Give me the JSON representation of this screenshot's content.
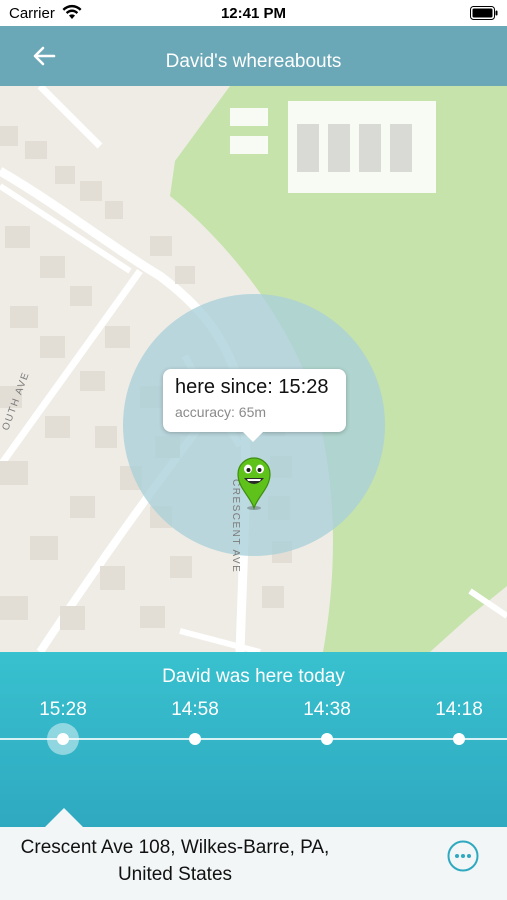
{
  "status_bar": {
    "carrier": "Carrier",
    "time": "12:41 PM"
  },
  "header": {
    "title": "David's whereabouts",
    "back_icon": "back-arrow-icon"
  },
  "map": {
    "streets": [
      "CRESCENT AVE",
      "OUTH AVE"
    ],
    "callout": {
      "since": "here since: 15:28",
      "accuracy": "accuracy: 65m"
    },
    "pin_icon": "smiley-pin-icon",
    "colors": {
      "accuracy_circle": "#a9cfd9",
      "park": "#c6e3ab",
      "land": "#efece6"
    }
  },
  "timeline": {
    "heading": "David was here today",
    "times": [
      "15:28",
      "14:58",
      "14:38",
      "14:18"
    ],
    "active_index": 0
  },
  "footer": {
    "address_line1": "Crescent Ave 108, Wilkes-Barre, PA,",
    "address_line2": "United States",
    "more_icon": "more-options-icon"
  }
}
